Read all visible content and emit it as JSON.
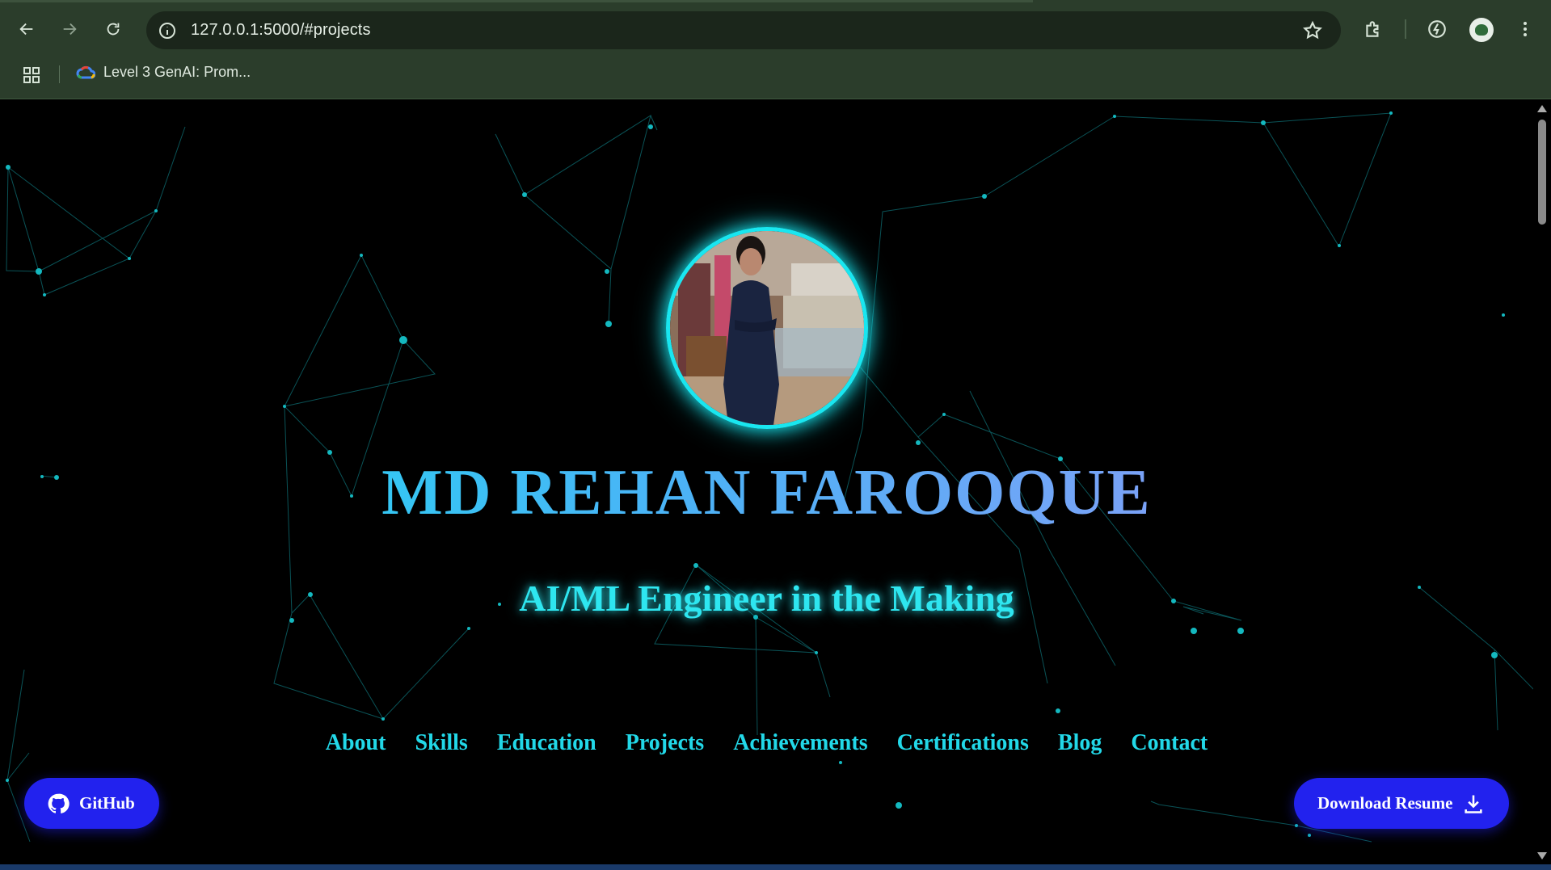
{
  "browser": {
    "url": "127.0.0.1:5000/#projects",
    "bookmark_label": "Level 3 GenAI: Prom...",
    "icons": [
      "back-arrow-icon",
      "forward-arrow-icon",
      "reload-icon",
      "site-info-icon",
      "bookmark-star-icon",
      "extensions-icon",
      "performance-icon",
      "profile-avatar",
      "more-menu-icon",
      "apps-grid-icon"
    ]
  },
  "hero": {
    "name": "MD REHAN FAROOQUE",
    "tagline": "AI/ML Engineer in the Making"
  },
  "nav": {
    "items": [
      "About",
      "Skills",
      "Education",
      "Projects",
      "Achievements",
      "Certifications",
      "Blog",
      "Contact"
    ]
  },
  "actions": {
    "github_label": "GitHub",
    "resume_label": "Download Resume"
  },
  "colors": {
    "accent_cyan": "#19e6f0",
    "button_blue": "#2222ee",
    "chrome_bg": "#2b3d2b",
    "page_bg": "#000000"
  }
}
